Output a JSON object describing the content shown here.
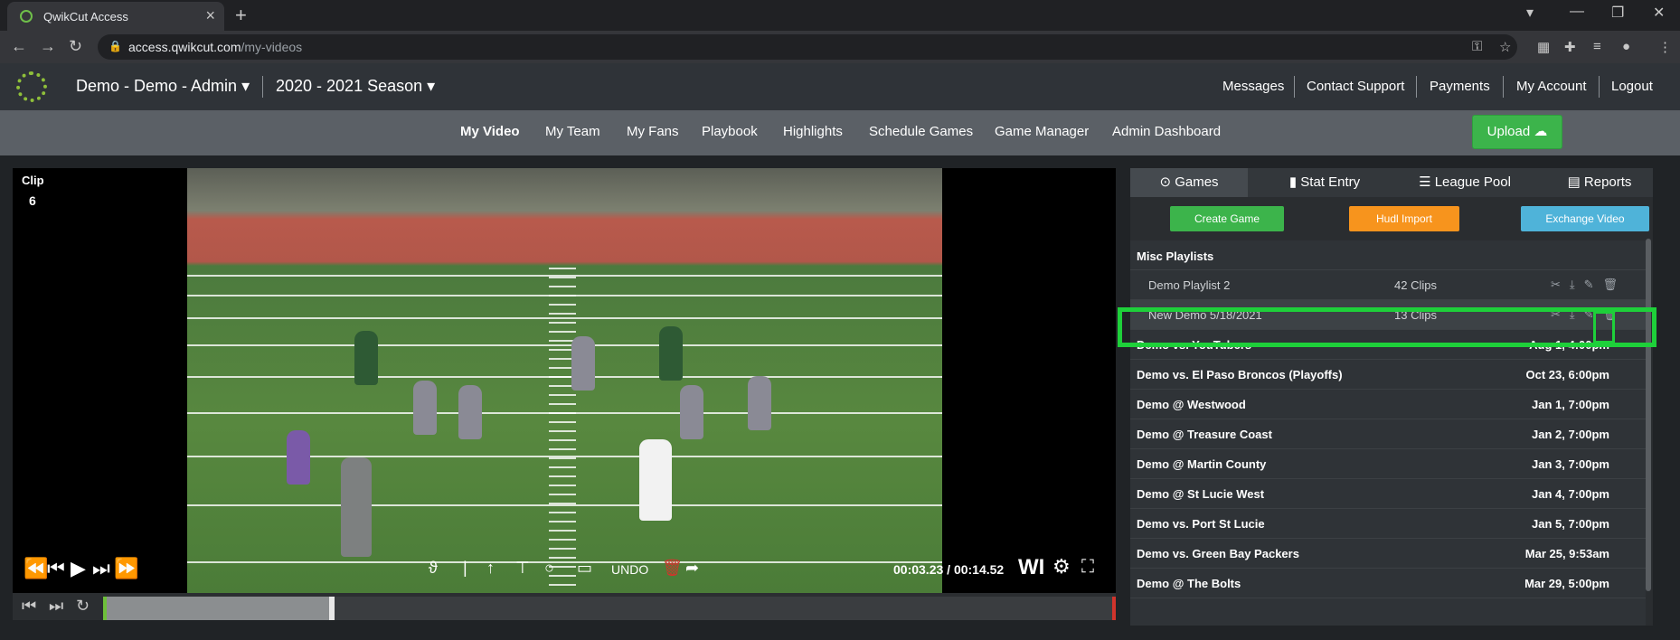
{
  "browser": {
    "tab_title": "QwikCut Access",
    "url_host": "access.qwikcut.com",
    "url_path": "/my-videos"
  },
  "header": {
    "account": "Demo - Demo - Admin",
    "season": "2020 - 2021 Season",
    "links": [
      "Messages",
      "Contact Support",
      "Payments",
      "My Account",
      "Logout"
    ]
  },
  "nav": {
    "items": [
      "My Video",
      "My Team",
      "My Fans",
      "Playbook",
      "Highlights",
      "Schedule Games",
      "Game Manager",
      "Admin Dashboard"
    ],
    "upload_label": "Upload"
  },
  "player": {
    "clip_label": "Clip",
    "clip_number": "6",
    "undo_label": "UNDO",
    "time": "00:03.23 / 00:14.52",
    "overlay_label": "WI"
  },
  "panel": {
    "tabs": [
      "Games",
      "Stat Entry",
      "League Pool",
      "Reports"
    ],
    "buttons": [
      "Create Game",
      "Hudl Import",
      "Exchange Video"
    ],
    "section": "Misc Playlists",
    "playlists": [
      {
        "name": "Demo Playlist 2",
        "clips": "42 Clips"
      },
      {
        "name": "New Demo 5/18/2021",
        "clips": "13 Clips"
      }
    ],
    "games": [
      {
        "name": "Demo vs. YouTubers",
        "date": "Aug 1, 4:00pm"
      },
      {
        "name": "Demo vs. El Paso Broncos (Playoffs)",
        "date": "Oct 23, 6:00pm"
      },
      {
        "name": "Demo @ Westwood",
        "date": "Jan 1, 7:00pm"
      },
      {
        "name": "Demo @ Treasure Coast",
        "date": "Jan 2, 7:00pm"
      },
      {
        "name": "Demo @ Martin County",
        "date": "Jan 3, 7:00pm"
      },
      {
        "name": "Demo @ St Lucie West",
        "date": "Jan 4, 7:00pm"
      },
      {
        "name": "Demo vs. Port St Lucie",
        "date": "Jan 5, 7:00pm"
      },
      {
        "name": "Demo vs. Green Bay Packers",
        "date": "Mar 25, 9:53am"
      },
      {
        "name": "Demo @ The Bolts",
        "date": "Mar 29, 5:00pm"
      }
    ]
  },
  "colors": {
    "accent_green": "#3cb44b",
    "hudl_orange": "#f7941d",
    "exchange_blue": "#4fb3d9",
    "highlight": "#1ed03a"
  }
}
